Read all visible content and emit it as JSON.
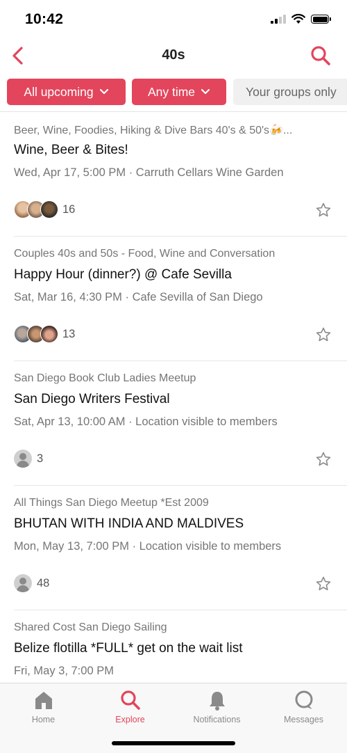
{
  "status_bar": {
    "time": "10:42"
  },
  "header": {
    "title": "40s"
  },
  "filters": [
    {
      "label": "All upcoming"
    },
    {
      "label": "Any time"
    },
    {
      "label": "Your groups only"
    }
  ],
  "events": [
    {
      "group": "Beer, Wine, Foodies, Hiking & Dive Bars 40's & 50's🍻...",
      "title": "Wine, Beer & Bites!",
      "meta": "Wed, Apr 17, 5:00 PM · Carruth Cellars Wine Garden",
      "attendee_count": "16"
    },
    {
      "group": "Couples 40s and 50s - Food, Wine and Conversation",
      "title": "Happy Hour (dinner?) @ Cafe Sevilla",
      "meta": "Sat, Mar 16, 4:30 PM · Cafe Sevilla of San Diego",
      "attendee_count": "13"
    },
    {
      "group": "San Diego Book Club Ladies Meetup",
      "title": "San Diego Writers Festival",
      "meta": "Sat, Apr 13, 10:00 AM · Location visible to members",
      "attendee_count": "3"
    },
    {
      "group": "All Things San Diego Meetup *Est 2009",
      "title": "BHUTAN WITH INDIA AND MALDIVES",
      "meta": "Mon, May 13, 7:00 PM · Location visible to members",
      "attendee_count": "48"
    },
    {
      "group": "Shared Cost San Diego Sailing",
      "title": "Belize flotilla *FULL* get on the wait list",
      "meta": "Fri, May 3, 7:00 PM"
    }
  ],
  "tabs": [
    {
      "label": "Home",
      "icon": "home-icon"
    },
    {
      "label": "Explore",
      "icon": "search-icon"
    },
    {
      "label": "Notifications",
      "icon": "bell-icon"
    },
    {
      "label": "Messages",
      "icon": "chat-bubble-icon"
    }
  ],
  "colors": {
    "accent": "#e2455c",
    "inactive": "#8a8a8a"
  }
}
